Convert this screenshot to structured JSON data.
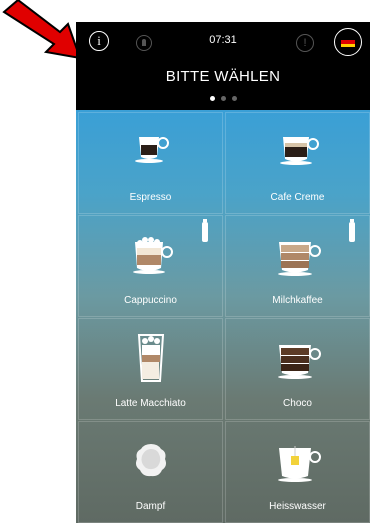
{
  "status": {
    "time": "07:31",
    "info_symbol": "i",
    "alert_symbol": "!",
    "language_flag": "de-flag-icon"
  },
  "header": {
    "title": "BITTE WÄHLEN",
    "pages": 3,
    "active_page": 1
  },
  "products": [
    {
      "label": "Espresso",
      "icon": "espresso-cup-icon"
    },
    {
      "label": "Cafe Creme",
      "icon": "cafe-creme-cup-icon"
    },
    {
      "label": "Cappuccino",
      "icon": "cappuccino-cup-icon",
      "milk": true
    },
    {
      "label": "Milchkaffee",
      "icon": "milchkaffee-cup-icon",
      "milk": true
    },
    {
      "label": "Latte Macchiato",
      "icon": "latte-macchiato-glass-icon"
    },
    {
      "label": "Choco",
      "icon": "choco-cup-icon"
    },
    {
      "label": "Dampf",
      "icon": "steam-icon"
    },
    {
      "label": "Heisswasser",
      "icon": "hot-water-cup-icon"
    }
  ],
  "colors": {
    "arrow": "#e00000",
    "grid_top": "#3a9fd6",
    "grid_bottom": "#5f6a63"
  }
}
